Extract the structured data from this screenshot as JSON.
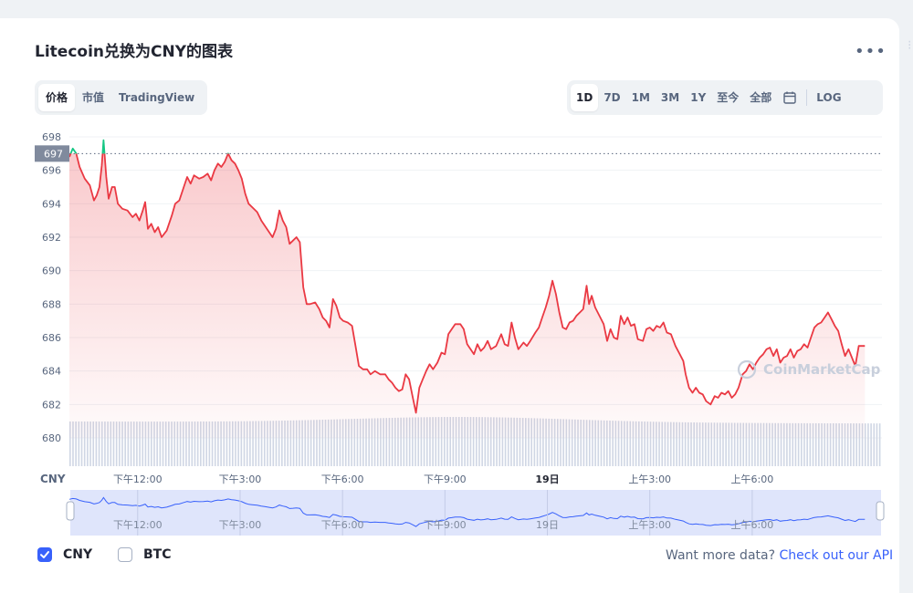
{
  "title": "Litecoin兑换为CNY的图表",
  "more_icon": "more-horizontal-icon",
  "view_tabs": [
    {
      "label": "价格",
      "active": true
    },
    {
      "label": "市值",
      "active": false
    },
    {
      "label": "TradingView",
      "active": false
    }
  ],
  "range_tabs": [
    {
      "label": "1D",
      "active": true
    },
    {
      "label": "7D",
      "active": false
    },
    {
      "label": "1M",
      "active": false
    },
    {
      "label": "3M",
      "active": false
    },
    {
      "label": "1Y",
      "active": false
    },
    {
      "label": "至今",
      "active": false
    },
    {
      "label": "全部",
      "active": false
    }
  ],
  "calendar_icon": "calendar-icon",
  "log_label": "LOG",
  "current_price_tag": "697",
  "currency_axis_label": "CNY",
  "watermark": "CoinMarketCap",
  "legend": [
    {
      "label": "CNY",
      "checked": true
    },
    {
      "label": "BTC",
      "checked": false
    }
  ],
  "api_prompt": "Want more data?",
  "api_link": "Check out our API",
  "colors": {
    "up": "#16c784",
    "down": "#ea3943",
    "accent": "#3861fb",
    "volume": "#cfd6e4"
  },
  "chart_data": {
    "type": "line",
    "x_start_hour": 10.0,
    "x_end_hour": 33.8,
    "ylim": [
      679,
      698.5
    ],
    "yticks": [
      698,
      696,
      694,
      692,
      690,
      688,
      686,
      684,
      682,
      680
    ],
    "reference_price": 697,
    "xtick_labels": [
      {
        "hour": 12,
        "label": "下午12:00",
        "bold": false
      },
      {
        "hour": 15,
        "label": "下午3:00",
        "bold": false
      },
      {
        "hour": 18,
        "label": "下午6:00",
        "bold": false
      },
      {
        "hour": 21,
        "label": "下午9:00",
        "bold": false
      },
      {
        "hour": 24,
        "label": "19日",
        "bold": true
      },
      {
        "hour": 27,
        "label": "上午3:00",
        "bold": false
      },
      {
        "hour": 30,
        "label": "上午6:00",
        "bold": false
      }
    ],
    "series": [
      {
        "name": "CNY",
        "points": [
          [
            10.0,
            696.8
          ],
          [
            10.1,
            697.3
          ],
          [
            10.2,
            697.0
          ],
          [
            10.3,
            696.2
          ],
          [
            10.45,
            695.5
          ],
          [
            10.6,
            695.1
          ],
          [
            10.72,
            694.2
          ],
          [
            10.8,
            694.5
          ],
          [
            10.88,
            695.0
          ],
          [
            10.95,
            696.3
          ],
          [
            11.0,
            697.8
          ],
          [
            11.08,
            695.6
          ],
          [
            11.15,
            694.3
          ],
          [
            11.25,
            695.0
          ],
          [
            11.33,
            695.0
          ],
          [
            11.42,
            694.0
          ],
          [
            11.55,
            693.7
          ],
          [
            11.7,
            693.6
          ],
          [
            11.85,
            693.2
          ],
          [
            11.95,
            693.4
          ],
          [
            12.05,
            693.0
          ],
          [
            12.15,
            693.6
          ],
          [
            12.22,
            694.1
          ],
          [
            12.3,
            692.5
          ],
          [
            12.4,
            692.8
          ],
          [
            12.5,
            692.3
          ],
          [
            12.6,
            692.6
          ],
          [
            12.7,
            692.0
          ],
          [
            12.85,
            692.4
          ],
          [
            13.0,
            693.3
          ],
          [
            13.1,
            694.0
          ],
          [
            13.22,
            694.2
          ],
          [
            13.35,
            695.0
          ],
          [
            13.45,
            695.6
          ],
          [
            13.55,
            695.2
          ],
          [
            13.65,
            695.7
          ],
          [
            13.8,
            695.5
          ],
          [
            13.92,
            695.6
          ],
          [
            14.05,
            695.8
          ],
          [
            14.15,
            695.4
          ],
          [
            14.25,
            696.0
          ],
          [
            14.35,
            696.4
          ],
          [
            14.45,
            696.2
          ],
          [
            14.55,
            696.5
          ],
          [
            14.65,
            697.0
          ],
          [
            14.75,
            696.6
          ],
          [
            14.85,
            696.4
          ],
          [
            14.95,
            696.0
          ],
          [
            15.05,
            695.5
          ],
          [
            15.15,
            694.6
          ],
          [
            15.25,
            694.0
          ],
          [
            15.35,
            693.8
          ],
          [
            15.5,
            693.5
          ],
          [
            15.62,
            693.0
          ],
          [
            15.72,
            692.7
          ],
          [
            15.85,
            692.3
          ],
          [
            15.95,
            692.0
          ],
          [
            16.05,
            692.5
          ],
          [
            16.15,
            693.6
          ],
          [
            16.25,
            693.0
          ],
          [
            16.35,
            692.6
          ],
          [
            16.45,
            691.6
          ],
          [
            16.55,
            691.8
          ],
          [
            16.65,
            692.0
          ],
          [
            16.75,
            691.7
          ],
          [
            16.85,
            689.0
          ],
          [
            16.95,
            688.0
          ],
          [
            17.05,
            688.0
          ],
          [
            17.2,
            688.1
          ],
          [
            17.32,
            687.7
          ],
          [
            17.42,
            687.2
          ],
          [
            17.52,
            687.0
          ],
          [
            17.62,
            686.6
          ],
          [
            17.72,
            688.3
          ],
          [
            17.82,
            687.9
          ],
          [
            17.92,
            687.2
          ],
          [
            18.02,
            687.0
          ],
          [
            18.15,
            686.9
          ],
          [
            18.28,
            686.7
          ],
          [
            18.38,
            685.5
          ],
          [
            18.48,
            684.3
          ],
          [
            18.6,
            684.1
          ],
          [
            18.72,
            684.1
          ],
          [
            18.82,
            683.8
          ],
          [
            18.95,
            684.0
          ],
          [
            19.1,
            683.8
          ],
          [
            19.25,
            683.8
          ],
          [
            19.35,
            683.5
          ],
          [
            19.45,
            683.3
          ],
          [
            19.55,
            683.0
          ],
          [
            19.65,
            682.8
          ],
          [
            19.75,
            682.9
          ],
          [
            19.85,
            683.8
          ],
          [
            19.95,
            683.5
          ],
          [
            20.05,
            682.5
          ],
          [
            20.15,
            681.5
          ],
          [
            20.25,
            683.0
          ],
          [
            20.35,
            683.5
          ],
          [
            20.45,
            684.0
          ],
          [
            20.55,
            684.4
          ],
          [
            20.65,
            684.1
          ],
          [
            20.78,
            684.5
          ],
          [
            20.9,
            685.1
          ],
          [
            21.0,
            685.0
          ],
          [
            21.1,
            686.2
          ],
          [
            21.2,
            686.5
          ],
          [
            21.3,
            686.8
          ],
          [
            21.45,
            686.8
          ],
          [
            21.55,
            686.5
          ],
          [
            21.65,
            685.6
          ],
          [
            21.75,
            685.3
          ],
          [
            21.85,
            685.0
          ],
          [
            21.95,
            685.6
          ],
          [
            22.05,
            685.2
          ],
          [
            22.15,
            685.4
          ],
          [
            22.25,
            685.8
          ],
          [
            22.35,
            685.3
          ],
          [
            22.5,
            685.5
          ],
          [
            22.65,
            686.2
          ],
          [
            22.75,
            685.6
          ],
          [
            22.85,
            685.5
          ],
          [
            22.95,
            686.9
          ],
          [
            23.05,
            686.0
          ],
          [
            23.15,
            685.3
          ],
          [
            23.3,
            685.7
          ],
          [
            23.4,
            685.5
          ],
          [
            23.5,
            685.8
          ],
          [
            23.65,
            686.3
          ],
          [
            23.75,
            686.6
          ],
          [
            23.85,
            687.2
          ],
          [
            23.95,
            687.8
          ],
          [
            24.05,
            688.5
          ],
          [
            24.15,
            689.4
          ],
          [
            24.25,
            688.6
          ],
          [
            24.35,
            687.5
          ],
          [
            24.45,
            686.6
          ],
          [
            24.55,
            686.5
          ],
          [
            24.65,
            686.9
          ],
          [
            24.75,
            687.0
          ],
          [
            24.85,
            687.3
          ],
          [
            24.95,
            687.5
          ],
          [
            25.05,
            687.7
          ],
          [
            25.15,
            689.1
          ],
          [
            25.22,
            688.0
          ],
          [
            25.3,
            688.5
          ],
          [
            25.4,
            687.8
          ],
          [
            25.55,
            687.2
          ],
          [
            25.65,
            686.8
          ],
          [
            25.75,
            685.8
          ],
          [
            25.85,
            686.5
          ],
          [
            25.95,
            686.0
          ],
          [
            26.05,
            685.9
          ],
          [
            26.15,
            687.3
          ],
          [
            26.25,
            686.8
          ],
          [
            26.35,
            687.2
          ],
          [
            26.45,
            686.7
          ],
          [
            26.55,
            686.8
          ],
          [
            26.65,
            685.9
          ],
          [
            26.8,
            685.8
          ],
          [
            26.9,
            686.5
          ],
          [
            27.0,
            686.6
          ],
          [
            27.1,
            686.4
          ],
          [
            27.2,
            686.7
          ],
          [
            27.3,
            686.6
          ],
          [
            27.4,
            686.9
          ],
          [
            27.5,
            686.3
          ],
          [
            27.62,
            686.2
          ],
          [
            27.75,
            685.5
          ],
          [
            27.88,
            685.0
          ],
          [
            27.98,
            684.6
          ],
          [
            28.05,
            683.8
          ],
          [
            28.15,
            683.0
          ],
          [
            28.25,
            682.7
          ],
          [
            28.35,
            683.0
          ],
          [
            28.45,
            682.7
          ],
          [
            28.55,
            682.6
          ],
          [
            28.65,
            682.2
          ],
          [
            28.78,
            682.0
          ],
          [
            28.9,
            682.5
          ],
          [
            29.0,
            682.4
          ],
          [
            29.1,
            682.7
          ],
          [
            29.2,
            682.6
          ],
          [
            29.3,
            682.8
          ],
          [
            29.4,
            682.4
          ],
          [
            29.5,
            682.6
          ],
          [
            29.6,
            683.0
          ],
          [
            29.72,
            683.8
          ],
          [
            29.82,
            684.0
          ],
          [
            29.92,
            684.4
          ],
          [
            30.02,
            684.1
          ],
          [
            30.12,
            684.5
          ],
          [
            30.22,
            684.8
          ],
          [
            30.32,
            685.0
          ],
          [
            30.42,
            685.3
          ],
          [
            30.52,
            685.4
          ],
          [
            30.62,
            684.9
          ],
          [
            30.72,
            685.3
          ],
          [
            30.82,
            684.5
          ],
          [
            30.92,
            684.8
          ],
          [
            31.02,
            684.9
          ],
          [
            31.12,
            685.3
          ],
          [
            31.22,
            684.8
          ],
          [
            31.32,
            685.2
          ],
          [
            31.42,
            685.3
          ],
          [
            31.52,
            685.6
          ],
          [
            31.62,
            685.4
          ],
          [
            31.72,
            686.0
          ],
          [
            31.82,
            686.6
          ],
          [
            31.92,
            686.8
          ],
          [
            32.02,
            686.9
          ],
          [
            32.12,
            687.2
          ],
          [
            32.22,
            687.5
          ],
          [
            32.32,
            687.1
          ],
          [
            32.42,
            686.7
          ],
          [
            32.52,
            686.4
          ],
          [
            32.62,
            685.6
          ],
          [
            32.72,
            684.9
          ],
          [
            32.82,
            685.3
          ],
          [
            32.92,
            684.8
          ],
          [
            33.02,
            684.3
          ],
          [
            33.12,
            685.5
          ],
          [
            33.22,
            685.5
          ],
          [
            33.3,
            685.5
          ]
        ]
      }
    ]
  }
}
